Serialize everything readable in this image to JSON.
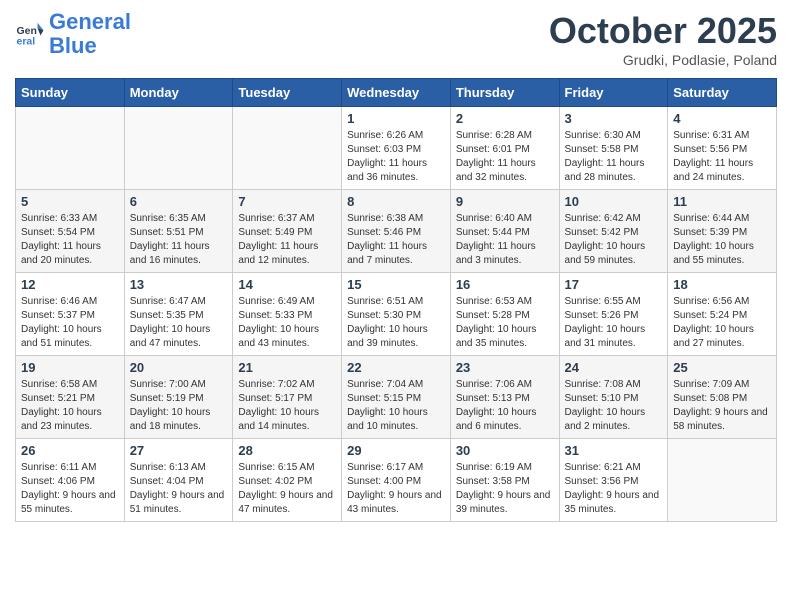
{
  "logo": {
    "line1": "General",
    "line2": "Blue"
  },
  "title": "October 2025",
  "subtitle": "Grudki, Podlasie, Poland",
  "headers": [
    "Sunday",
    "Monday",
    "Tuesday",
    "Wednesday",
    "Thursday",
    "Friday",
    "Saturday"
  ],
  "weeks": [
    [
      {
        "day": "",
        "detail": ""
      },
      {
        "day": "",
        "detail": ""
      },
      {
        "day": "",
        "detail": ""
      },
      {
        "day": "1",
        "detail": "Sunrise: 6:26 AM\nSunset: 6:03 PM\nDaylight: 11 hours and 36 minutes."
      },
      {
        "day": "2",
        "detail": "Sunrise: 6:28 AM\nSunset: 6:01 PM\nDaylight: 11 hours and 32 minutes."
      },
      {
        "day": "3",
        "detail": "Sunrise: 6:30 AM\nSunset: 5:58 PM\nDaylight: 11 hours and 28 minutes."
      },
      {
        "day": "4",
        "detail": "Sunrise: 6:31 AM\nSunset: 5:56 PM\nDaylight: 11 hours and 24 minutes."
      }
    ],
    [
      {
        "day": "5",
        "detail": "Sunrise: 6:33 AM\nSunset: 5:54 PM\nDaylight: 11 hours and 20 minutes."
      },
      {
        "day": "6",
        "detail": "Sunrise: 6:35 AM\nSunset: 5:51 PM\nDaylight: 11 hours and 16 minutes."
      },
      {
        "day": "7",
        "detail": "Sunrise: 6:37 AM\nSunset: 5:49 PM\nDaylight: 11 hours and 12 minutes."
      },
      {
        "day": "8",
        "detail": "Sunrise: 6:38 AM\nSunset: 5:46 PM\nDaylight: 11 hours and 7 minutes."
      },
      {
        "day": "9",
        "detail": "Sunrise: 6:40 AM\nSunset: 5:44 PM\nDaylight: 11 hours and 3 minutes."
      },
      {
        "day": "10",
        "detail": "Sunrise: 6:42 AM\nSunset: 5:42 PM\nDaylight: 10 hours and 59 minutes."
      },
      {
        "day": "11",
        "detail": "Sunrise: 6:44 AM\nSunset: 5:39 PM\nDaylight: 10 hours and 55 minutes."
      }
    ],
    [
      {
        "day": "12",
        "detail": "Sunrise: 6:46 AM\nSunset: 5:37 PM\nDaylight: 10 hours and 51 minutes."
      },
      {
        "day": "13",
        "detail": "Sunrise: 6:47 AM\nSunset: 5:35 PM\nDaylight: 10 hours and 47 minutes."
      },
      {
        "day": "14",
        "detail": "Sunrise: 6:49 AM\nSunset: 5:33 PM\nDaylight: 10 hours and 43 minutes."
      },
      {
        "day": "15",
        "detail": "Sunrise: 6:51 AM\nSunset: 5:30 PM\nDaylight: 10 hours and 39 minutes."
      },
      {
        "day": "16",
        "detail": "Sunrise: 6:53 AM\nSunset: 5:28 PM\nDaylight: 10 hours and 35 minutes."
      },
      {
        "day": "17",
        "detail": "Sunrise: 6:55 AM\nSunset: 5:26 PM\nDaylight: 10 hours and 31 minutes."
      },
      {
        "day": "18",
        "detail": "Sunrise: 6:56 AM\nSunset: 5:24 PM\nDaylight: 10 hours and 27 minutes."
      }
    ],
    [
      {
        "day": "19",
        "detail": "Sunrise: 6:58 AM\nSunset: 5:21 PM\nDaylight: 10 hours and 23 minutes."
      },
      {
        "day": "20",
        "detail": "Sunrise: 7:00 AM\nSunset: 5:19 PM\nDaylight: 10 hours and 18 minutes."
      },
      {
        "day": "21",
        "detail": "Sunrise: 7:02 AM\nSunset: 5:17 PM\nDaylight: 10 hours and 14 minutes."
      },
      {
        "day": "22",
        "detail": "Sunrise: 7:04 AM\nSunset: 5:15 PM\nDaylight: 10 hours and 10 minutes."
      },
      {
        "day": "23",
        "detail": "Sunrise: 7:06 AM\nSunset: 5:13 PM\nDaylight: 10 hours and 6 minutes."
      },
      {
        "day": "24",
        "detail": "Sunrise: 7:08 AM\nSunset: 5:10 PM\nDaylight: 10 hours and 2 minutes."
      },
      {
        "day": "25",
        "detail": "Sunrise: 7:09 AM\nSunset: 5:08 PM\nDaylight: 9 hours and 58 minutes."
      }
    ],
    [
      {
        "day": "26",
        "detail": "Sunrise: 6:11 AM\nSunset: 4:06 PM\nDaylight: 9 hours and 55 minutes."
      },
      {
        "day": "27",
        "detail": "Sunrise: 6:13 AM\nSunset: 4:04 PM\nDaylight: 9 hours and 51 minutes."
      },
      {
        "day": "28",
        "detail": "Sunrise: 6:15 AM\nSunset: 4:02 PM\nDaylight: 9 hours and 47 minutes."
      },
      {
        "day": "29",
        "detail": "Sunrise: 6:17 AM\nSunset: 4:00 PM\nDaylight: 9 hours and 43 minutes."
      },
      {
        "day": "30",
        "detail": "Sunrise: 6:19 AM\nSunset: 3:58 PM\nDaylight: 9 hours and 39 minutes."
      },
      {
        "day": "31",
        "detail": "Sunrise: 6:21 AM\nSunset: 3:56 PM\nDaylight: 9 hours and 35 minutes."
      },
      {
        "day": "",
        "detail": ""
      }
    ]
  ]
}
